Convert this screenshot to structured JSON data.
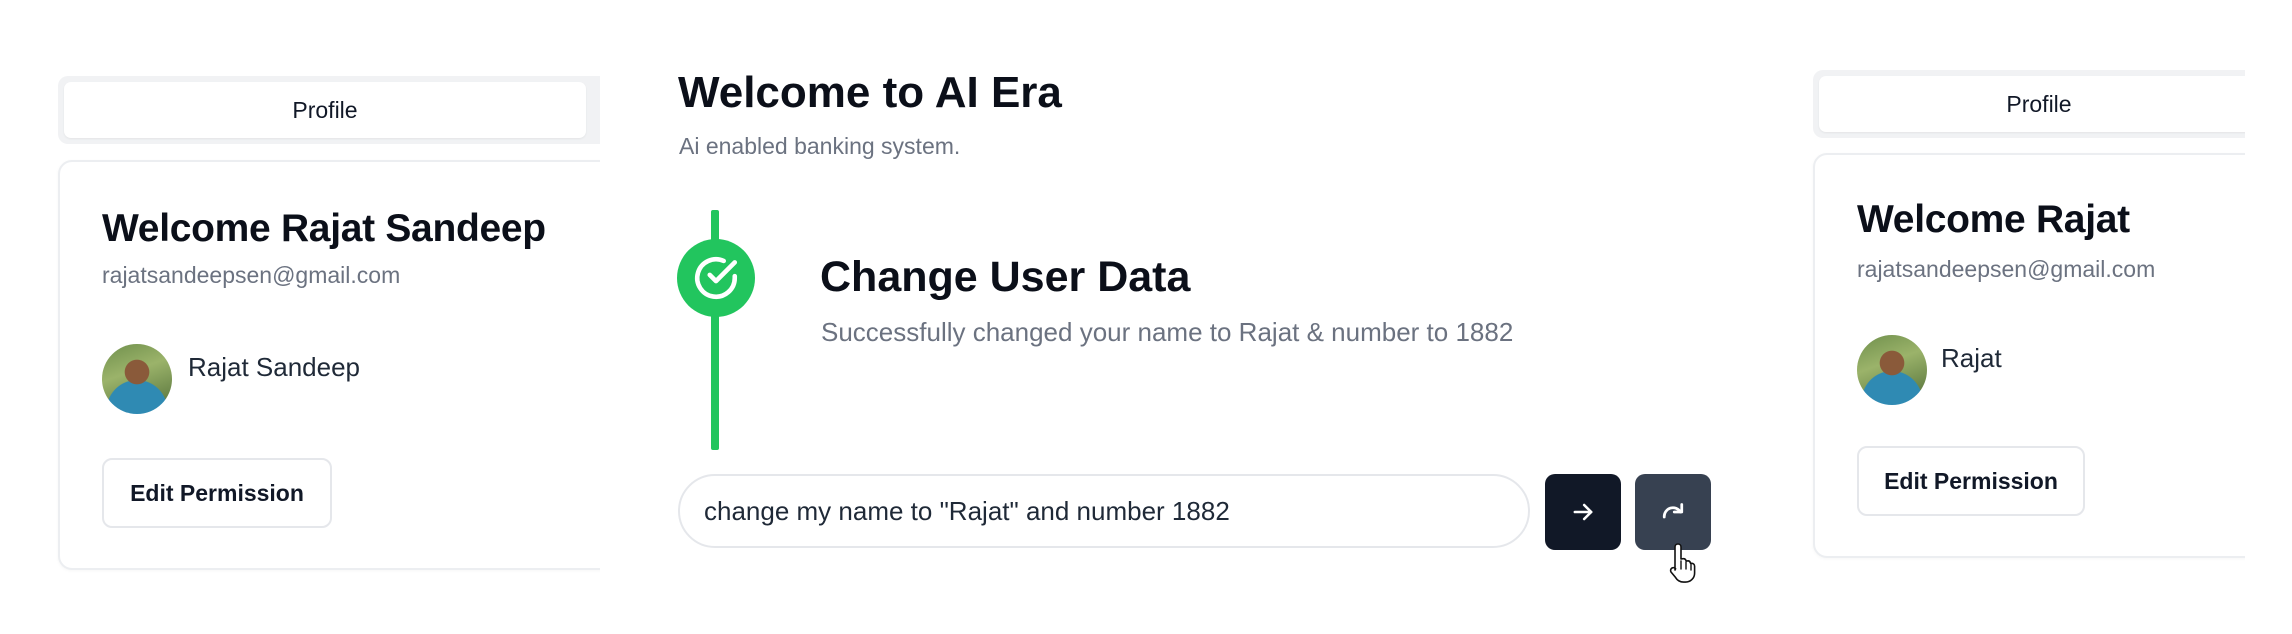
{
  "left_profile": {
    "tab_label": "Profile",
    "welcome": "Welcome Rajat Sandeep",
    "email": "rajatsandeepsen@gmail.com",
    "user_name": "Rajat Sandeep",
    "edit_button": "Edit Permission"
  },
  "center": {
    "title": "Welcome to AI Era",
    "subtitle": "Ai enabled banking system.",
    "step": {
      "icon": "check-circle-icon",
      "title": "Change User Data",
      "description": "Successfully changed your name to Rajat & number to 1882"
    },
    "prompt_value": "change my name to \"Rajat\" and number 1882",
    "send_icon": "arrow-right-icon",
    "redo_icon": "redo-icon"
  },
  "right_profile": {
    "tab_label": "Profile",
    "welcome": "Welcome Rajat",
    "email": "rajatsandeepsen@gmail.com",
    "user_name": "Rajat",
    "edit_button": "Edit Permission"
  },
  "colors": {
    "accent_green": "#22c55e",
    "dark_button": "#111827",
    "muted_text": "#6b7280"
  }
}
